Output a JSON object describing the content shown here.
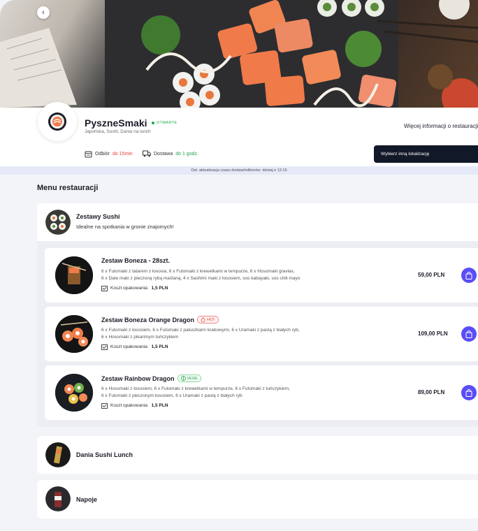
{
  "hero": {
    "back_icon": "chevron-left-icon"
  },
  "restaurant": {
    "name": "PyszneSmaki",
    "status": "OTWARTE",
    "cuisines": "Japońska, Sushi, Dania na lunch",
    "more_info": "Więcej informacji o restauracji",
    "pickup_label": "Odbiór",
    "pickup_time": "do 15min",
    "delivery_label": "Dostawa",
    "delivery_time": "do 1 godz.",
    "location_button": "Wybierz inną lokalizację",
    "update_text": "Ost. aktualizacja czasu dostaw/odbiorów: dzisiaj o 12:15"
  },
  "menu": {
    "title": "Menu restauracji",
    "categories": [
      {
        "name": "Zestawy Sushi",
        "description": "Idealne na spotkania w gronie znajomych!"
      },
      {
        "name": "Dania Sushi Lunch"
      },
      {
        "name": "Napoje"
      }
    ],
    "pack_label": "Koszt opakowania:",
    "products": [
      {
        "name": "Zestaw Boneza - 28szt.",
        "badge": "",
        "desc1": "6 x Futomaki z tatarem z łososia, 6 x Futomaki z krewetkami w tempurze, 6 x Hosomaki gravlax,",
        "desc2": "6 x Date maki z pieczoną rybą maślaną, 4 x Sashimi maki z łososiem, sos kabayaki, sos chili mayo",
        "pack_price": "1,5 PLN",
        "price": "59,00 PLN"
      },
      {
        "name": "Zestaw Boneza Orange Dragon",
        "badge": "HOT",
        "desc1": "6 x Futomaki z łososiem, 6 x Futomaki z paluszkami krabowymi, 6 x Uramaki z pastą z białych ryb,",
        "desc2": "6 x Hosomaki z pikantnym tuńczykiem",
        "pack_price": "1,5 PLN",
        "price": "109,00 PLN"
      },
      {
        "name": "Zestaw Rainbow Dragon",
        "badge": "VEGE",
        "desc1": "6 x Hosomaki z łososiem, 6 x Futomaki z krewetkami w tempurze, 6 x Futomaki z tuńczykiem,",
        "desc2": "6 x Futomaki z pieczonym łososiem, 6 x Uramaki z pastą z białych ryb",
        "pack_price": "1,5 PLN",
        "price": "89,00 PLN"
      }
    ]
  },
  "colors": {
    "accent": "#5a4df6",
    "dark_button": "#111827",
    "open_green": "#1aa94a",
    "hot_red": "#e5423a"
  }
}
